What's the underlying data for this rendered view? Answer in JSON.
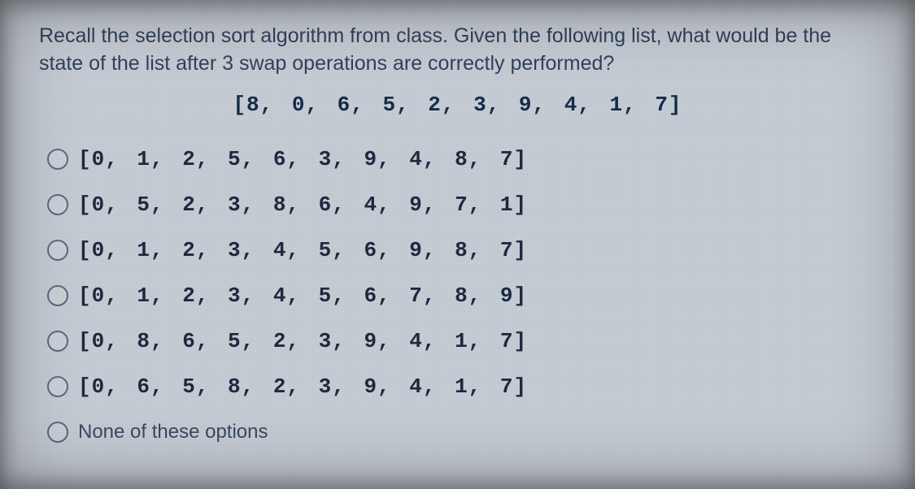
{
  "question": {
    "prompt": "Recall the selection sort algorithm from class. Given the following list, what would be the state of the list after 3 swap operations are correctly performed?",
    "initial_list": "[8, 0, 6, 5, 2, 3, 9, 4, 1, 7]"
  },
  "options": [
    {
      "label": "[0, 1, 2, 5, 6, 3, 9, 4, 8, 7]",
      "mono": true
    },
    {
      "label": "[0, 5, 2, 3, 8, 6, 4, 9, 7, 1]",
      "mono": true
    },
    {
      "label": "[0, 1, 2, 3, 4, 5, 6, 9, 8, 7]",
      "mono": true
    },
    {
      "label": "[0, 1, 2, 3, 4, 5, 6, 7, 8, 9]",
      "mono": true
    },
    {
      "label": "[0, 8, 6, 5, 2, 3, 9, 4, 1, 7]",
      "mono": true
    },
    {
      "label": "[0, 6, 5, 8, 2, 3, 9, 4, 1, 7]",
      "mono": true
    },
    {
      "label": "None of these options",
      "mono": false
    }
  ]
}
